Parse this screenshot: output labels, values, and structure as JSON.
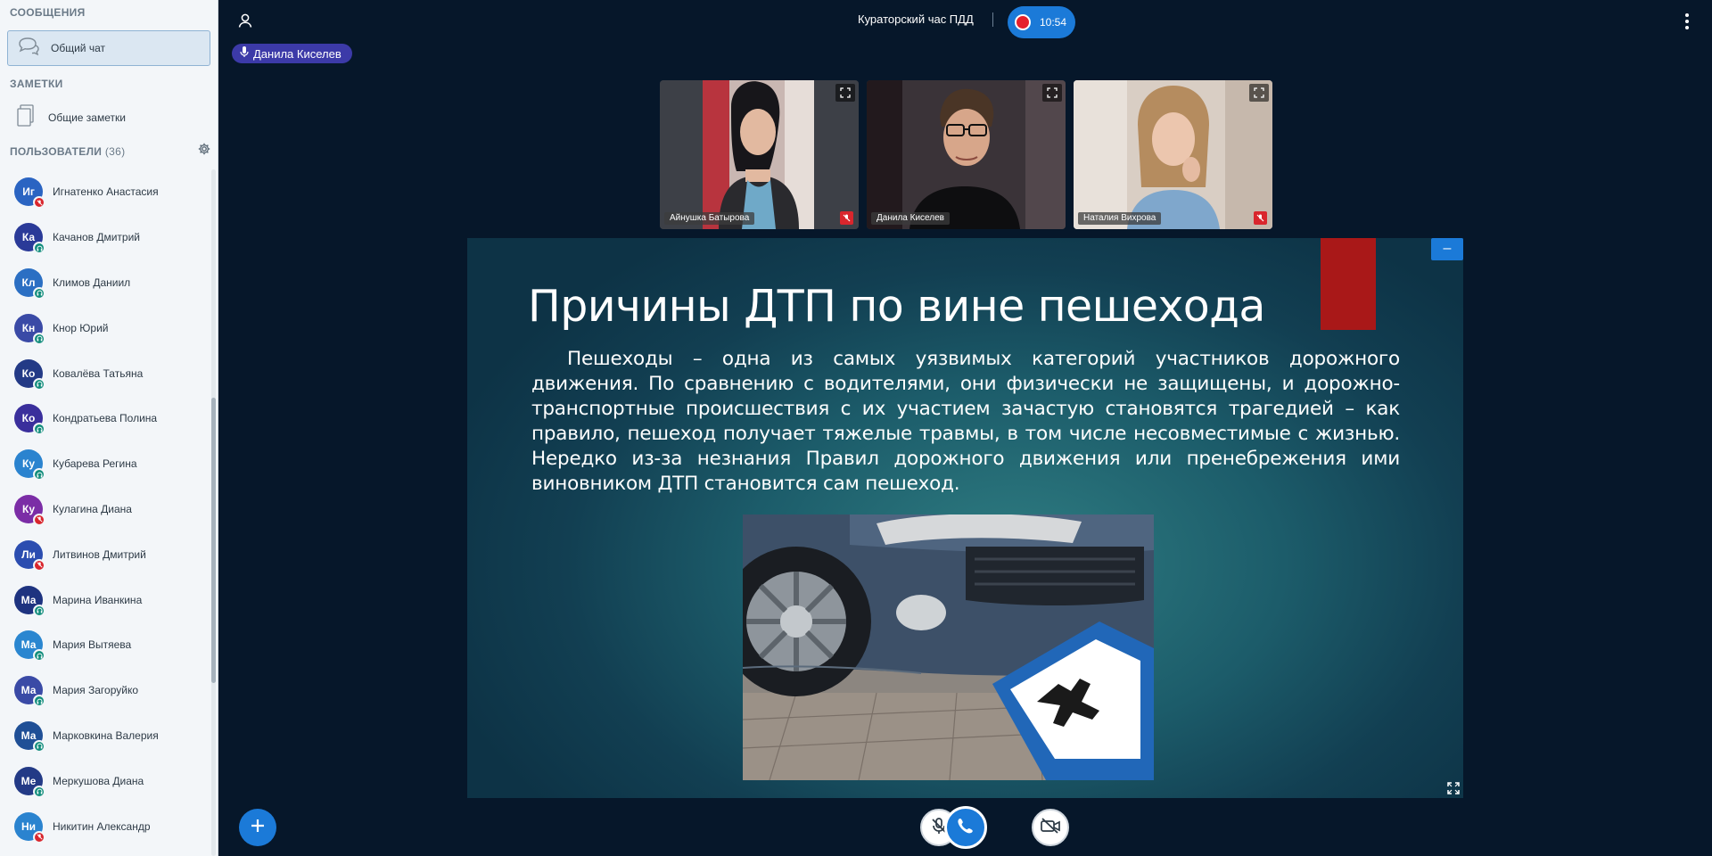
{
  "sidebar": {
    "messages_title": "СООБЩЕНИЯ",
    "public_chat": "Общий чат",
    "notes_title": "ЗАМЕТКИ",
    "shared_notes": "Общие заметки",
    "users_title": "ПОЛЬЗОВАТЕЛИ",
    "users_count": "(36)",
    "users": [
      {
        "initials": "Иг",
        "name": "Игнатенко Анастасия",
        "color": "#2a64c2",
        "status": "mic-muted"
      },
      {
        "initials": "Ка",
        "name": "Качанов Дмитрий",
        "color": "#2a3a98",
        "status": "listen-only"
      },
      {
        "initials": "Кл",
        "name": "Климов Даниил",
        "color": "#2b6fc3",
        "status": "listen-only"
      },
      {
        "initials": "Кн",
        "name": "Кнор Юрий",
        "color": "#3a4aa6",
        "status": "listen-only"
      },
      {
        "initials": "Ко",
        "name": "Ковалёва Татьяна",
        "color": "#233a86",
        "status": "listen-only"
      },
      {
        "initials": "Ко",
        "name": "Кондратьева Полина",
        "color": "#3a2f9c",
        "status": "listen-only"
      },
      {
        "initials": "Ку",
        "name": "Кубарева Регина",
        "color": "#2a83cf",
        "status": "listen-only"
      },
      {
        "initials": "Ку",
        "name": "Кулагина Диана",
        "color": "#7b2da6",
        "status": "mic-muted"
      },
      {
        "initials": "Ли",
        "name": "Литвинов Дмитрий",
        "color": "#2b4db0",
        "status": "mic-muted"
      },
      {
        "initials": "Ма",
        "name": "Марина Иванкина",
        "color": "#1e3380",
        "status": "listen-only"
      },
      {
        "initials": "Ма",
        "name": "Мария Вытяева",
        "color": "#2a86d0",
        "status": "listen-only"
      },
      {
        "initials": "Ма",
        "name": "Мария Загоруйко",
        "color": "#3a4aa6",
        "status": "listen-only"
      },
      {
        "initials": "Ма",
        "name": "Марковкина Валерия",
        "color": "#1f4f96",
        "status": "listen-only"
      },
      {
        "initials": "Ме",
        "name": "Меркушова Диана",
        "color": "#233a86",
        "status": "listen-only"
      },
      {
        "initials": "Ни",
        "name": "Никитин Александр",
        "color": "#2a83cf",
        "status": "mic-muted"
      }
    ]
  },
  "header": {
    "meeting_title": "Кураторский час ПДД",
    "recording_time": "10:54",
    "talking_indicator": "Данила Киселев"
  },
  "videos": [
    {
      "name": "Айнушка Батырова",
      "muted": true
    },
    {
      "name": "Данила Киселев",
      "muted": false
    },
    {
      "name": "Наталия Вихрова",
      "muted": true
    }
  ],
  "presentation": {
    "title": "Причины ДТП по вине пешехода",
    "body": "Пешеходы – одна из самых уязвимых категорий участников дорожного движения. По сравнению с водителями, они физически не защищены, и дорожно-транспортные происшествия с их участием зачастую становятся трагедией – как правило, пешеход получает тяжелые травмы, в том числе несовместимые с жизнью. Нередко из-за незнания Правил дорожного движения или пренебрежения ими виновником ДТП становится сам пешеход.",
    "accent_color": "#a91818",
    "minimize_label": "–"
  },
  "colors": {
    "background": "#06172a",
    "primary": "#1b7ad8",
    "recording": "#e5202c",
    "talking": "#3c3aa8"
  }
}
